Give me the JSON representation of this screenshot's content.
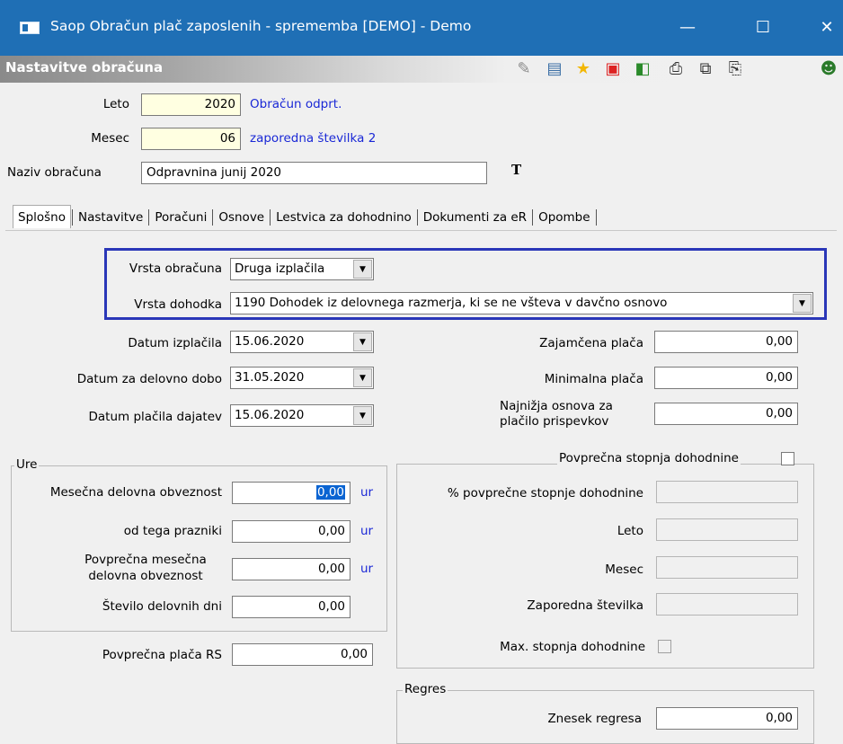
{
  "window": {
    "title": "Saop Obračun plač zaposlenih - sprememba [DEMO] - Demo",
    "minimize": "—",
    "maximize": "☐",
    "close": "✕"
  },
  "section_title": "Nastavitve obračuna",
  "toolbar": {
    "icons": [
      "edit-icon",
      "calculator-icon",
      "star-icon",
      "delete-icon",
      "cube-icon",
      "print-icon",
      "export-icon",
      "copy-icon",
      "person-icon"
    ]
  },
  "header": {
    "leto_label": "Leto",
    "leto_value": "2020",
    "leto_status": "Obračun odprt.",
    "mesec_label": "Mesec",
    "mesec_value": "06",
    "mesec_status": "zaporedna številka 2",
    "naziv_label": "Naziv obračuna",
    "naziv_value": "Odpravnina junij 2020",
    "font_icon": "T"
  },
  "tabs": [
    "Splošno",
    "Nastavitve",
    "Poračuni",
    "Osnove",
    "Lestvica za dohodnino",
    "Dokumenti za eR",
    "Opombe"
  ],
  "general": {
    "vrsta_obracuna_label": "Vrsta obračuna",
    "vrsta_obracuna_value": "Druga izplačila",
    "vrsta_dohodka_label": "Vrsta dohodka",
    "vrsta_dohodka_value": "1190  Dohodek iz delovnega razmerja, ki se ne všteva v davčno osnovo",
    "datum_izplacila_label": "Datum izplačila",
    "datum_izplacila_value": "15.06.2020",
    "datum_delovno_label": "Datum za delovno dobo",
    "datum_delovno_value": "31.05.2020",
    "datum_dajatev_label": "Datum plačila dajatev",
    "datum_dajatev_value": "15.06.2020",
    "zajamcena_label": "Zajamčena plača",
    "zajamcena_value": "0,00",
    "minimalna_label": "Minimalna plača",
    "minimalna_value": "0,00",
    "najnizja_label_1": "Najnižja osnova za",
    "najnizja_label_2": "plačilo prispevkov",
    "najnizja_value": "0,00"
  },
  "ure": {
    "legend": "Ure",
    "mesecna_label": "Mesečna delovna obveznost",
    "mesecna_value": "0,00",
    "prazniki_label": "od tega prazniki",
    "prazniki_value": "0,00",
    "povprecna_label_1": "Povprečna mesečna",
    "povprecna_label_2": "delovna obveznost",
    "povprecna_value": "0,00",
    "dni_label": "Število delovnih dni",
    "dni_value": "0,00",
    "unit": "ur"
  },
  "povprecna_placa_label": "Povprečna plača RS",
  "povprecna_placa_value": "0,00",
  "dohodnina": {
    "legend": "Povprečna stopnja dohodnine",
    "odstotek_label": "% povprečne stopnje dohodnine",
    "leto_label": "Leto",
    "mesec_label": "Mesec",
    "zaporedna_label": "Zaporedna številka",
    "max_label": "Max. stopnja dohodnine"
  },
  "regres": {
    "legend": "Regres",
    "znesek_label": "Znesek regresa",
    "znesek_value": "0,00"
  }
}
